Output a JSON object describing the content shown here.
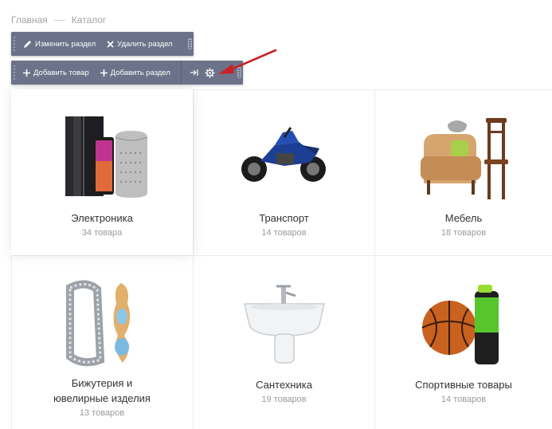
{
  "breadcrumb": {
    "items": [
      "Главная",
      "Каталог"
    ]
  },
  "toolbar_section": {
    "edit_label": "Изменить раздел",
    "delete_label": "Удалить раздел"
  },
  "toolbar_add": {
    "add_product_label": "Добавить товар",
    "add_section_label": "Добавить раздел"
  },
  "categories": [
    {
      "name": "Электроника",
      "count": "34 товара"
    },
    {
      "name": "Транспорт",
      "count": "14 товаров"
    },
    {
      "name": "Мебель",
      "count": "18 товаров"
    },
    {
      "name_line1": "Бижутерия и",
      "name_line2": "ювелирные изделия",
      "count": "13 товаров"
    },
    {
      "name": "Сантехника",
      "count": "19 товаров"
    },
    {
      "name": "Спортивные товары",
      "count": "14 товаров"
    }
  ],
  "colors": {
    "toolbar_bg": "#6b7289",
    "arrow": "#c8232a"
  }
}
